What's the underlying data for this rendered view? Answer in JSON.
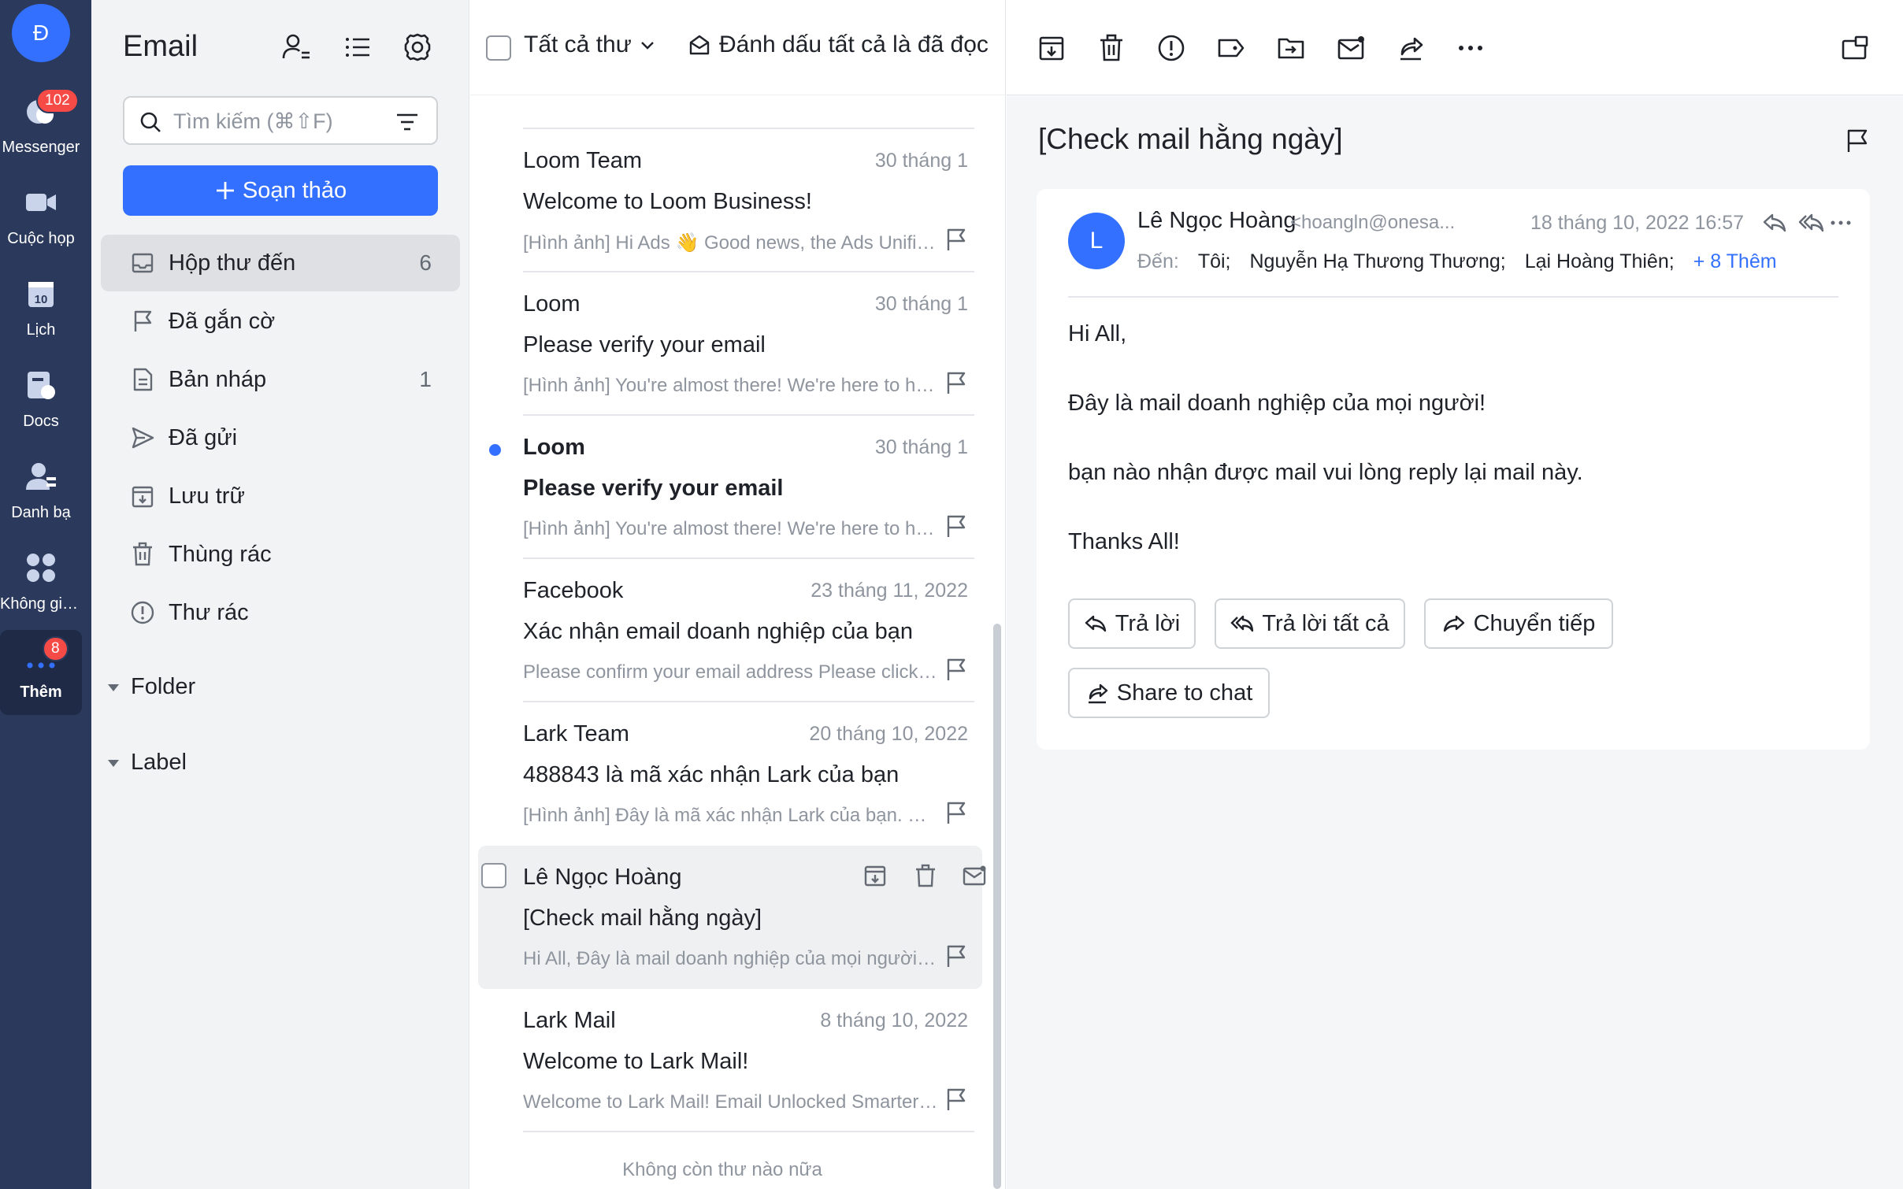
{
  "rail": {
    "avatar_letter": "Đ",
    "items": [
      {
        "label": "Messenger",
        "badge": "102",
        "icon": "chat-bubbles-icon"
      },
      {
        "label": "Cuộc họp",
        "icon": "video-camera-icon"
      },
      {
        "label": "Lịch",
        "icon": "calendar-icon",
        "icon_text": "10"
      },
      {
        "label": "Docs",
        "icon": "docs-icon"
      },
      {
        "label": "Danh bạ",
        "icon": "contacts-icon"
      },
      {
        "label": "Không gia...",
        "icon": "apps-grid-icon"
      },
      {
        "label": "Thêm",
        "badge": "8",
        "icon": "more-dots-icon",
        "active": true
      }
    ]
  },
  "sidebar": {
    "title": "Email",
    "search_placeholder": "Tìm kiếm (⌘⇧F)",
    "compose_label": "Soạn thảo",
    "folders": [
      {
        "label": "Hộp thư đến",
        "count": "6",
        "icon": "inbox-icon",
        "active": true
      },
      {
        "label": "Đã gắn cờ",
        "count": "",
        "icon": "flag-icon"
      },
      {
        "label": "Bản nháp",
        "count": "1",
        "icon": "draft-icon"
      },
      {
        "label": "Đã gửi",
        "count": "",
        "icon": "sent-icon"
      },
      {
        "label": "Lưu trữ",
        "count": "",
        "icon": "archive-icon"
      },
      {
        "label": "Thùng rác",
        "count": "",
        "icon": "trash-icon"
      },
      {
        "label": "Thư rác",
        "count": "",
        "icon": "spam-icon"
      }
    ],
    "groups": [
      "Folder",
      "Label"
    ]
  },
  "list": {
    "filter_label": "Tất cả thư",
    "mark_all_label": "Đánh dấu tất cả là đã đọc",
    "end_text": "Không còn thư nào nữa",
    "mails": [
      {
        "from": "Loom Team",
        "date": "30 tháng 1",
        "subject": "Welcome to Loom Business!",
        "preview": "[Hình ảnh] Hi Ads 👋 Good news, the Ads Unified Team workspace has been upgraded",
        "unread": false
      },
      {
        "from": "Loom",
        "date": "30 tháng 1",
        "subject": "Please verify your email",
        "preview": "[Hình ảnh] You're almost there! We're here to help you",
        "unread": false
      },
      {
        "from": "Loom",
        "date": "30 tháng 1",
        "subject": "Please verify your email",
        "preview": "[Hình ảnh] You're almost there! We're here to help you",
        "unread": true
      },
      {
        "from": "Facebook",
        "date": "23 tháng 11, 2022",
        "subject": "Xác nhận email doanh nghiệp của bạn",
        "preview": "Please confirm your email address Please click the link below",
        "unread": false
      },
      {
        "from": "Lark Team",
        "date": "20 tháng 10, 2022",
        "subject": "488843 là mã xác nhận Lark của bạn",
        "preview": "[Hình ảnh] Đây là mã xác nhận Lark của bạn. Mã này",
        "unread": false
      },
      {
        "from": "Lê Ngọc Hoàng",
        "date": "",
        "subject": "[Check mail hằng ngày]",
        "preview": "Hi All, Đây là mail doanh nghiệp của mọi người! bạn nào nhận được mail",
        "unread": false,
        "selected": true
      },
      {
        "from": "Lark Mail",
        "date": "8 tháng 10, 2022",
        "subject": "Welcome to Lark Mail!",
        "preview": "Welcome to Lark Mail! Email Unlocked Smarter collaboration",
        "unread": false
      }
    ]
  },
  "reader": {
    "title": "[Check mail hằng ngày]",
    "sender_initial": "L",
    "sender_name": "Lê Ngọc Hoàng",
    "sender_email": "<hoangln@onesa...",
    "date": "18 tháng 10, 2022 16:57",
    "to_label": "Đến:",
    "recipients": [
      "Tôi;",
      "Nguyễn Hạ Thương Thương;",
      "Lại Hoàng Thiên;"
    ],
    "more_recipients": "+ 8 Thêm",
    "body": [
      "Hi All,",
      "Đây là mail doanh nghiệp của mọi người!",
      "bạn nào nhận được mail vui lòng reply lại mail này.",
      "Thanks All!"
    ],
    "buttons": {
      "reply": "Trả lời",
      "reply_all": "Trả lời tất cả",
      "forward": "Chuyển tiếp",
      "share": "Share to chat"
    }
  },
  "colors": {
    "accent": "#3370ff",
    "rail_bg": "#2b3a5c",
    "badge": "#f54a45",
    "sidebar_bg": "#f2f3f5"
  }
}
